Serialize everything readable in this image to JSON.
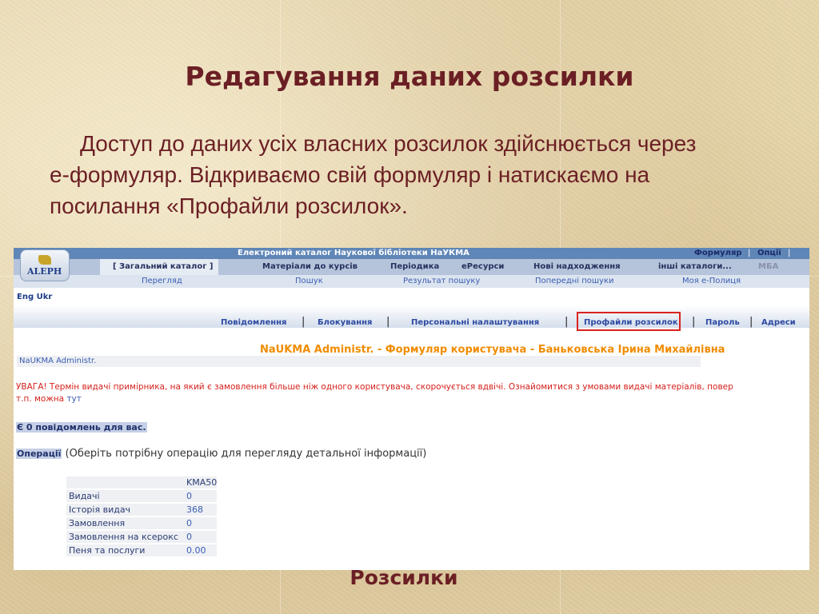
{
  "slide": {
    "title": "Редагування даних розсилки",
    "body_line1": "Доступ до даних усіх власних розсилок здійснюється через",
    "body_line2": "е-формуляр. Відкриваємо свій формуляр і натискаємо на",
    "body_line3": "посилання «Профайли розсилок».",
    "caption": "Розсилки"
  },
  "app": {
    "window_title": "Електроний каталог Наукової бібліотеки НаУКМА",
    "top_right": {
      "formular": "Формуляр",
      "options": "Опції"
    },
    "logo_text": "ALEPH",
    "tabs": [
      {
        "label": "[ Загальний каталог ]",
        "active": true
      },
      {
        "label": "Матеріали до курсів"
      },
      {
        "label": "Періодика"
      },
      {
        "label": "еРесурси"
      },
      {
        "label": "Нові надходження"
      },
      {
        "label": "інші каталоги..."
      },
      {
        "label": "МБА",
        "disabled": true
      }
    ],
    "nav_links": [
      "Перегляд",
      "Пошук",
      "Результат пошуку",
      "Попередні пошуки",
      "Моя е-Полиця"
    ],
    "lang": "Eng Ukr",
    "subnav": [
      "Повідомлення",
      "Блокування",
      "Персональні налаштування",
      "Профайли розсилок",
      "Пароль",
      "Адреси"
    ],
    "highlighted_link": "Профайли розсилок",
    "heading": "NaUKMA Administr. - Формуляр користувача - Баньковська Ірина Михайлівна",
    "admin_label": "NaUKMA Administr.",
    "warning_line1": "УВАГА! Термін видачі примірника, на який є замовлення більше ніж одного користувача, скорочується вдвічі. Ознайомитися з умовами видачі матеріалів, повер",
    "warning_line2_prefix": "т.п. можна ",
    "warning_link": "тут",
    "messages": "Є 0 повідомлень для вас.",
    "operations_label": "Операції",
    "operations_hint": " (Оберіть потрібну операцію для перегляду детальної інформації)",
    "table": {
      "column": "KMA50",
      "rows": [
        {
          "label": "Видачі",
          "value": "0"
        },
        {
          "label": "Історія видач",
          "value": "368"
        },
        {
          "label": "Замовлення",
          "value": "0"
        },
        {
          "label": "Замовлення на ксерокс",
          "value": "0"
        },
        {
          "label": "Пеня та послуги",
          "value": "0.00"
        }
      ]
    }
  },
  "colors": {
    "slide_text": "#6b1f24",
    "topbar": "#5f86b6",
    "tabbar": "#b5c3db",
    "heading_orange": "#f08c00",
    "warning_red": "#d4211c",
    "highlight_box": "#d9231f"
  }
}
